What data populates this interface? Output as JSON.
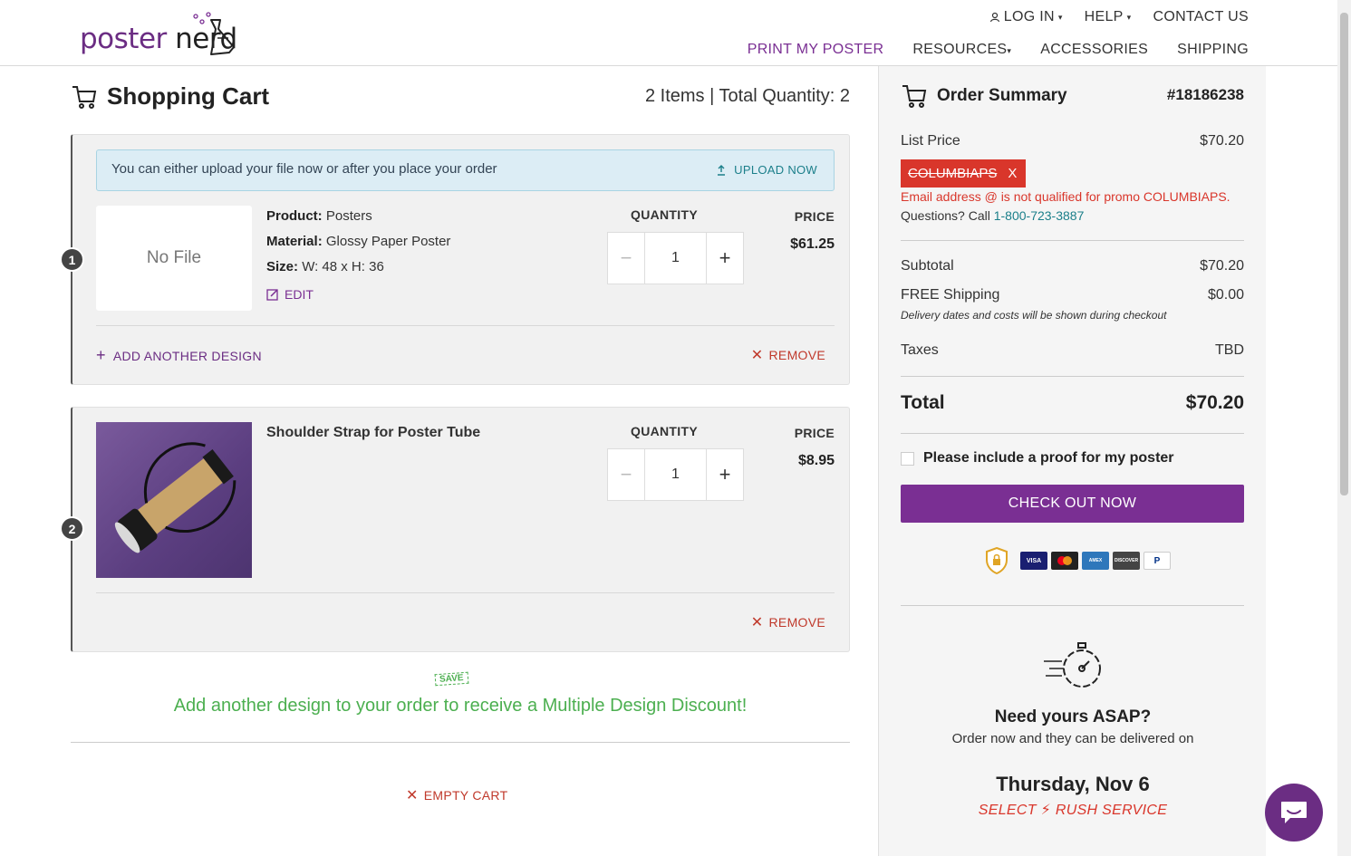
{
  "header": {
    "logo_part1": "poster",
    "logo_part2": "nerd",
    "top_nav": {
      "login": "LOG IN",
      "help": "HELP",
      "contact": "CONTACT US"
    },
    "main_nav": {
      "print": "PRINT MY POSTER",
      "resources": "RESOURCES",
      "accessories": "ACCESSORIES",
      "shipping": "SHIPPING"
    }
  },
  "cart": {
    "title": "Shopping Cart",
    "summary_line": "2 Items |  Total Quantity: 2",
    "upload_notice": "You can either upload your file now or after you place your order",
    "upload_button": "UPLOAD NOW",
    "qty_header": "QUANTITY",
    "price_header": "PRICE",
    "remove_label": "REMOVE",
    "items": [
      {
        "number": "1",
        "thumb_text": "No File",
        "product_label": "Product:",
        "product_value": "Posters",
        "material_label": "Material:",
        "material_value": "Glossy Paper Poster",
        "size_label": "Size:",
        "size_value": "W: 48 x H: 36",
        "edit_label": "EDIT",
        "quantity": "1",
        "price": "$61.25",
        "add_design": "ADD ANOTHER DESIGN"
      },
      {
        "number": "2",
        "name": "Shoulder Strap for Poster Tube",
        "quantity": "1",
        "price": "$8.95"
      }
    ],
    "save_tag": "SAVE",
    "promo_message": "Add another design to your order to receive a Multiple Design Discount!",
    "empty_cart": "EMPTY CART"
  },
  "summary": {
    "title": "Order Summary",
    "order_number": "#18186238",
    "list_price_label": "List Price",
    "list_price_value": "$70.20",
    "promo_code": "COLUMBIAPS",
    "promo_remove": "X",
    "promo_error": "Email address @ is not qualified for promo COLUMBIAPS.",
    "questions_label": "Questions? Call",
    "phone": "1-800-723-3887",
    "subtotal_label": "Subtotal",
    "subtotal_value": "$70.20",
    "shipping_label": "FREE Shipping",
    "shipping_value": "$0.00",
    "delivery_note": "Delivery dates and costs will be shown during checkout",
    "taxes_label": "Taxes",
    "taxes_value": "TBD",
    "total_label": "Total",
    "total_value": "$70.20",
    "proof_label": "Please include a proof for my poster",
    "checkout_label": "CHECK OUT NOW",
    "cards": [
      "VISA",
      "MC",
      "AMEX",
      "DISCOVER",
      "P"
    ],
    "asap_title": "Need yours ASAP?",
    "asap_sub": "Order now and they can be delivered on",
    "asap_date": "Thursday, Nov 6",
    "rush_select": "SELECT",
    "rush_service": "RUSH SERVICE"
  },
  "colors": {
    "brand": "#7a2f93",
    "error": "#d9362b",
    "success": "#4caf50",
    "link": "#1b7f8a"
  }
}
